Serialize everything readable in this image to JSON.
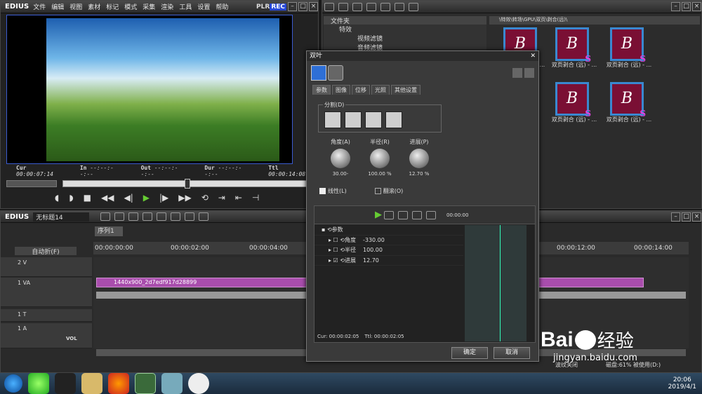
{
  "preview": {
    "logo": "EDIUS",
    "menu": [
      "文件",
      "编辑",
      "视图",
      "素材",
      "标记",
      "模式",
      "采集",
      "渲染",
      "工具",
      "设置",
      "帮助"
    ],
    "plr": "PLR",
    "rec": "REC",
    "cur_label": "Cur",
    "cur": "00:00:07:14",
    "in_label": "In",
    "in": "--:--:--:--",
    "out_label": "Out",
    "out": "--:--:--:--",
    "dur_label": "Dur",
    "dur": "--:--:--:--",
    "ttl_label": "Ttl",
    "ttl": "00:00:14:08"
  },
  "bin": {
    "tree_header": "文件夹",
    "tree": [
      "特效",
      "视频滤镜",
      "音频滤镜"
    ],
    "path": "\\特效\\转场\\GPU\\双页\\剥合(远)\\",
    "thumbs": [
      "双页剥合 (远) - ...",
      "双页剥合 (远) - ...",
      "双页剥合 (远) - ...",
      "双页剥合 (远) - ...",
      "双页剥合 (远) - ..."
    ]
  },
  "dialog": {
    "title": "双叶",
    "tabs": [
      "参数",
      "图像",
      "位移",
      "光照",
      "其他设置"
    ],
    "split_label": "分割(D)",
    "knobs": [
      {
        "label": "角度(A)",
        "value": "30.00-"
      },
      {
        "label": "半径(R)",
        "value": "100.00 %"
      },
      {
        "label": "进展(P)",
        "value": "12.70 %"
      }
    ],
    "check_linear": "线性(L)",
    "check_flip": "翻滚(O)",
    "kf_time": "00:00:00",
    "rows": [
      {
        "name": "参数",
        "value": ""
      },
      {
        "name": "角度",
        "value": "-330.00"
      },
      {
        "name": "半径",
        "value": "100.00"
      },
      {
        "name": "进展",
        "value": "12.70"
      }
    ],
    "cur": "Cur: 00:00:02:05",
    "ttl": "Ttl: 00:00:02:05",
    "ok": "确定",
    "cancel": "取消"
  },
  "timeline": {
    "logo": "EDIUS",
    "project": "无标题14",
    "seq": "序列1",
    "mode": "自动折(F)",
    "ruler": [
      "00:00:00:00",
      "00:00:02:00",
      "00:00:04:00",
      "00:00:12:00",
      "00:00:14:00"
    ],
    "tracks": [
      "2 V",
      "1 VA",
      "1 T",
      "1 A"
    ],
    "vol": "VOL",
    "clip": "1440x900_2d7edf917d28899",
    "status_left": "波纹关闭",
    "status_right": "磁盘:61% 被使用(D:)"
  },
  "taskbar": {
    "time": "20:06",
    "date": "2019/4/1"
  },
  "watermark": {
    "brand": "Bai",
    "brand2": "经验",
    "url": "jingyan.baidu.com"
  }
}
